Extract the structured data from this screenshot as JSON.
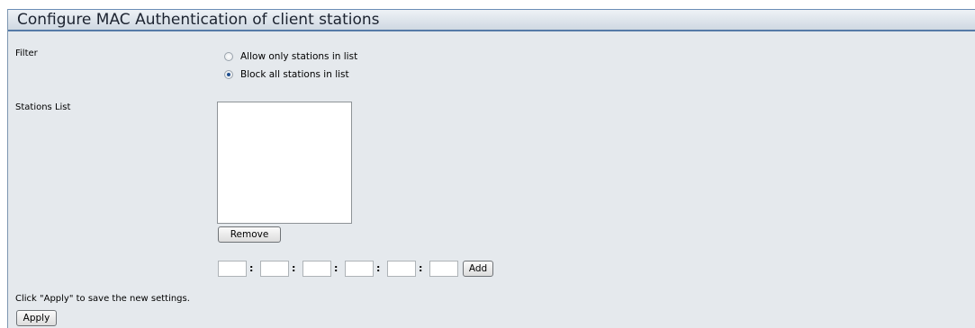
{
  "title": "Configure MAC Authentication of client stations",
  "filter": {
    "label": "Filter",
    "options": [
      {
        "label": "Allow only stations in list",
        "checked": false
      },
      {
        "label": "Block all stations in list",
        "checked": true
      }
    ]
  },
  "stations": {
    "label": "Stations List",
    "remove_label": "Remove",
    "add_label": "Add",
    "mac_separator": ":",
    "mac_fields": [
      "",
      "",
      "",
      "",
      "",
      ""
    ]
  },
  "footer": {
    "hint": "Click \"Apply\" to save the new settings.",
    "apply_label": "Apply"
  }
}
